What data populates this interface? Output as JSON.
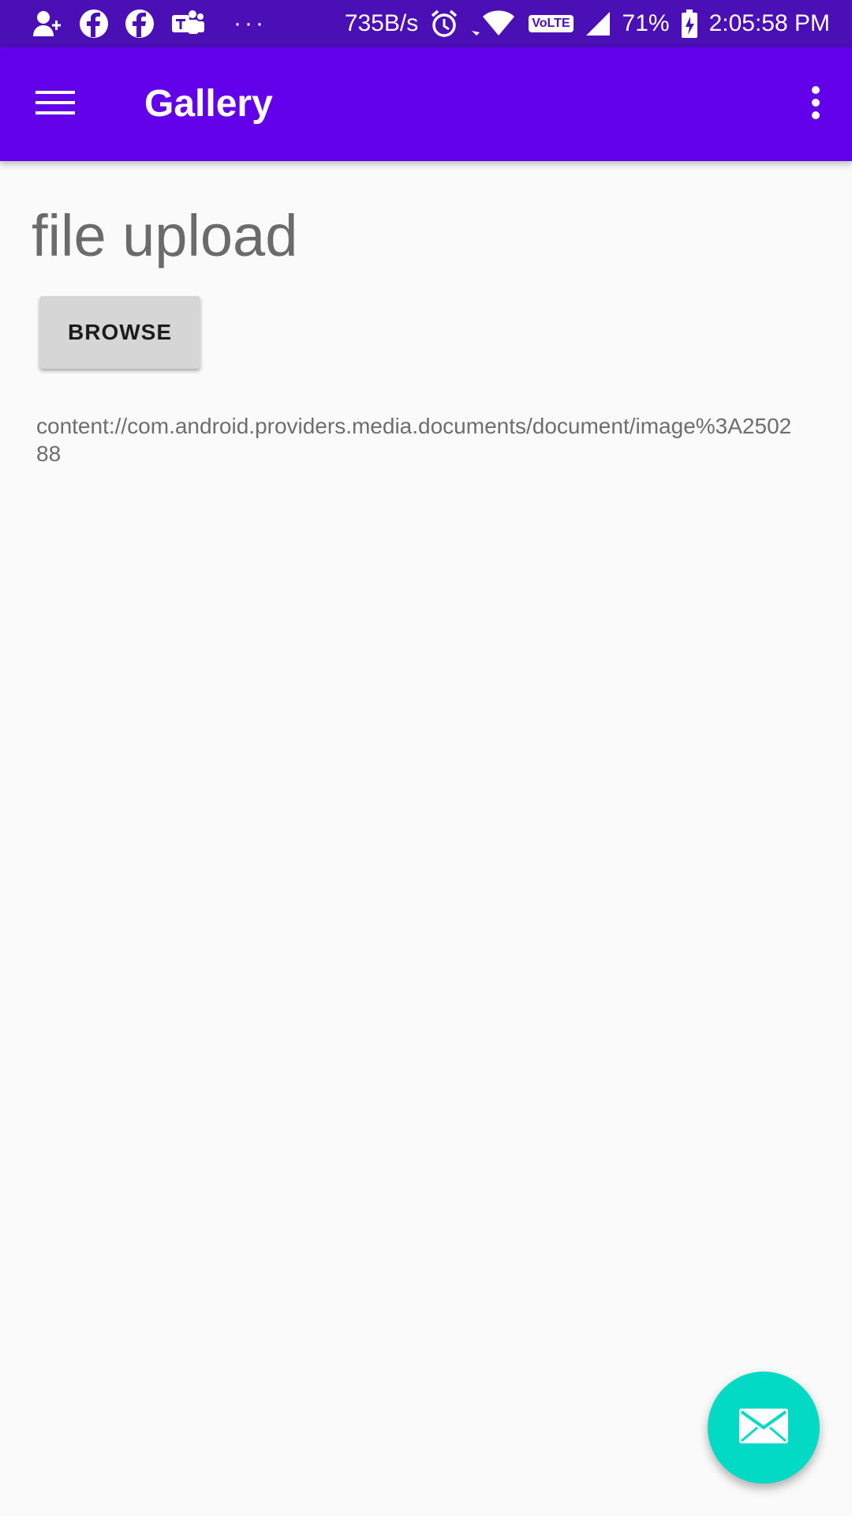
{
  "status_bar": {
    "icons": [
      "add-contact-icon",
      "facebook-icon",
      "facebook-icon",
      "teams-icon",
      "more-dots-icon",
      "alarm-icon",
      "wifi-icon",
      "volte-icon",
      "signal-icon",
      "battery-charging-icon"
    ],
    "more_dots": "···",
    "net_speed": "735B/s",
    "volte_label": "VoLTE",
    "battery": "71%",
    "time": "2:05:58 PM"
  },
  "app_bar": {
    "title": "Gallery",
    "menu_icon": "hamburger-menu-icon",
    "overflow_icon": "more-vert-icon",
    "color": "#6200ea"
  },
  "main": {
    "heading": "file upload",
    "browse_label": "BROWSE",
    "uri": "content://com.android.providers.media.documents/document/image%3A250288"
  },
  "fab": {
    "icon": "email-icon",
    "color": "#03dac5"
  },
  "colors": {
    "status_bar": "#4a0fb5",
    "background": "#fafafa"
  }
}
